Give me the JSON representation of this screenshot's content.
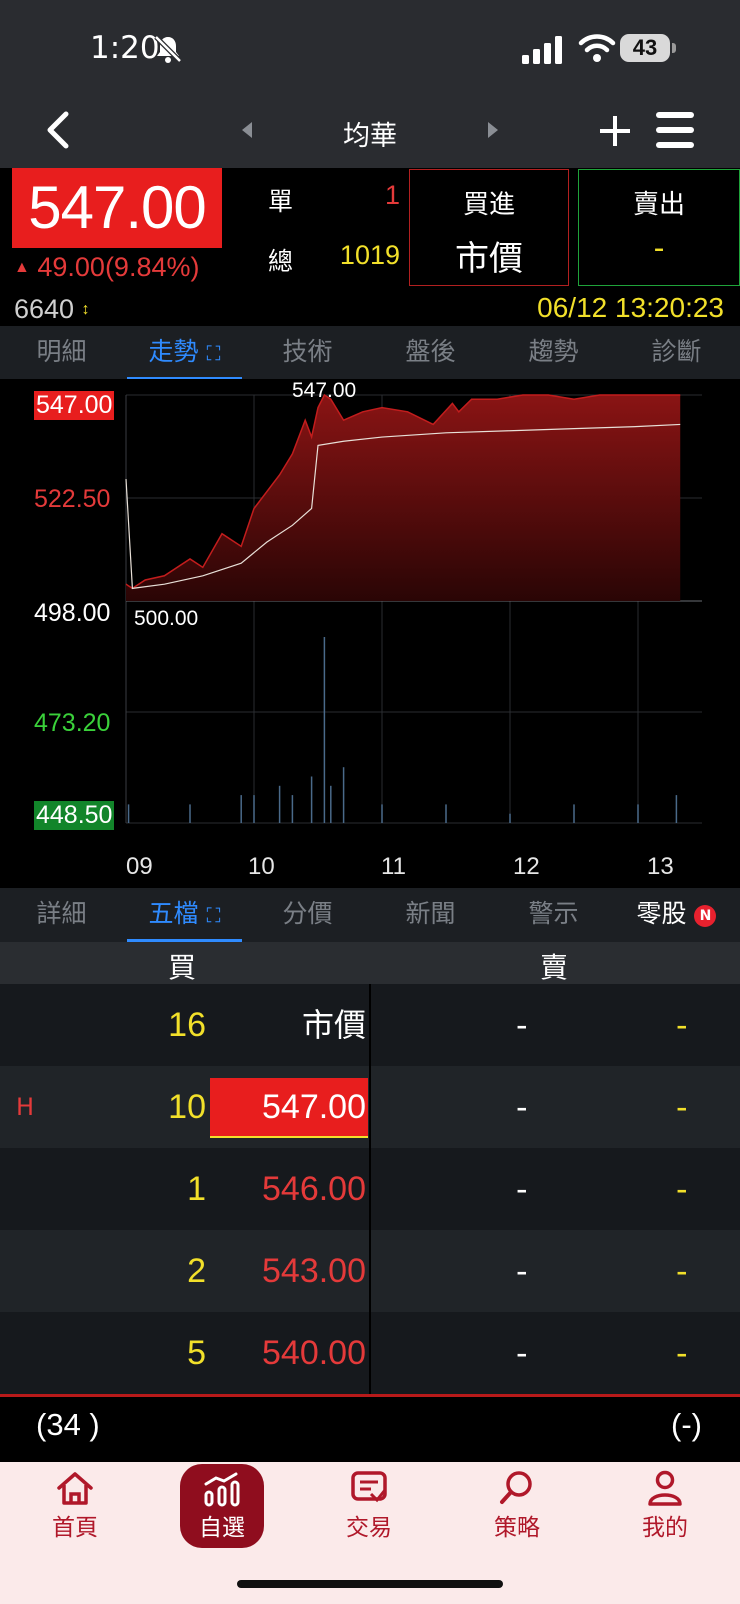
{
  "status": {
    "time": "1:20",
    "battery": "43"
  },
  "nav": {
    "title": "均華"
  },
  "quote": {
    "price": "547.00",
    "change": "49.00",
    "change_pct": "(9.84%)",
    "single_label": "單",
    "single_value": "1",
    "total_label": "總",
    "total_value": "1019",
    "buy_label": "買進",
    "buy_price": "市價",
    "sell_label": "賣出",
    "sell_price": "-",
    "volume": "6640",
    "datetime": "06/12 13:20:23"
  },
  "tabs_top": [
    "明細",
    "走勢",
    "技術",
    "盤後",
    "趨勢",
    "診斷"
  ],
  "tabs_top_active": 1,
  "chart_data": {
    "type": "area",
    "y_ticks": [
      "547.00",
      "522.50",
      "498.00",
      "473.20",
      "448.50"
    ],
    "x_ticks": [
      "09",
      "10",
      "11",
      "12",
      "13"
    ],
    "ylim": [
      448.5,
      547.0
    ],
    "reference_price": 498.0,
    "high_label": "547.00",
    "low_label": "500.00",
    "colors": {
      "up": "#e81e1e",
      "ref": "#ffffff",
      "down": "#3ad13a"
    },
    "price_series": {
      "x": [
        9.0,
        9.05,
        9.15,
        9.3,
        9.5,
        9.6,
        9.75,
        9.9,
        10.0,
        10.1,
        10.2,
        10.3,
        10.4,
        10.45,
        10.5,
        10.55,
        10.6,
        10.7,
        10.85,
        11.0,
        11.2,
        11.4,
        11.55,
        11.6,
        11.7,
        11.9,
        12.1,
        12.3,
        12.5,
        12.7,
        12.9,
        13.1,
        13.33
      ],
      "y": [
        502,
        501,
        503,
        504,
        508,
        506,
        514,
        511,
        520,
        524,
        528,
        533,
        541,
        537,
        544,
        547,
        546,
        541,
        543,
        544,
        543,
        540,
        545,
        543,
        546,
        546,
        547,
        547,
        546,
        547,
        547,
        547,
        547
      ]
    },
    "avg_series": {
      "x": [
        9.0,
        9.05,
        9.3,
        9.6,
        9.9,
        10.1,
        10.3,
        10.45,
        10.5,
        10.7,
        11.0,
        11.5,
        12.0,
        12.5,
        13.0,
        13.33
      ],
      "y": [
        527,
        501,
        502,
        504,
        507,
        512,
        516,
        520,
        535,
        536,
        537,
        538,
        538.5,
        539,
        539.5,
        540
      ]
    },
    "volume_bars": {
      "x": [
        9.02,
        9.5,
        9.9,
        10.0,
        10.2,
        10.3,
        10.45,
        10.55,
        10.6,
        10.7,
        11.0,
        11.5,
        12.0,
        12.5,
        13.0,
        13.3
      ],
      "v": [
        2,
        2,
        3,
        3,
        4,
        3,
        5,
        20,
        4,
        6,
        2,
        2,
        1,
        2,
        2,
        3
      ]
    }
  },
  "tabs_bottom": [
    "詳細",
    "五檔",
    "分價",
    "新聞",
    "警示",
    "零股"
  ],
  "tabs_bottom_active": 1,
  "tabs_bottom_badge": "N",
  "book": {
    "buy_header": "買",
    "sell_header": "賣",
    "rows": [
      {
        "mark": "",
        "count": "16",
        "price": "市價",
        "sell_price": "-",
        "sell_count": "-"
      },
      {
        "mark": "H",
        "count": "10",
        "price": "547.00",
        "sell_price": "-",
        "sell_count": "-"
      },
      {
        "mark": "",
        "count": "1",
        "price": "546.00",
        "sell_price": "-",
        "sell_count": "-"
      },
      {
        "mark": "",
        "count": "2",
        "price": "543.00",
        "sell_price": "-",
        "sell_count": "-"
      },
      {
        "mark": "",
        "count": "5",
        "price": "540.00",
        "sell_price": "-",
        "sell_count": "-"
      }
    ],
    "buy_total": "(34 )",
    "sell_total": "(-)"
  },
  "bottom_nav": [
    "首頁",
    "自選",
    "交易",
    "策略",
    "我的"
  ],
  "bottom_nav_active": 1
}
